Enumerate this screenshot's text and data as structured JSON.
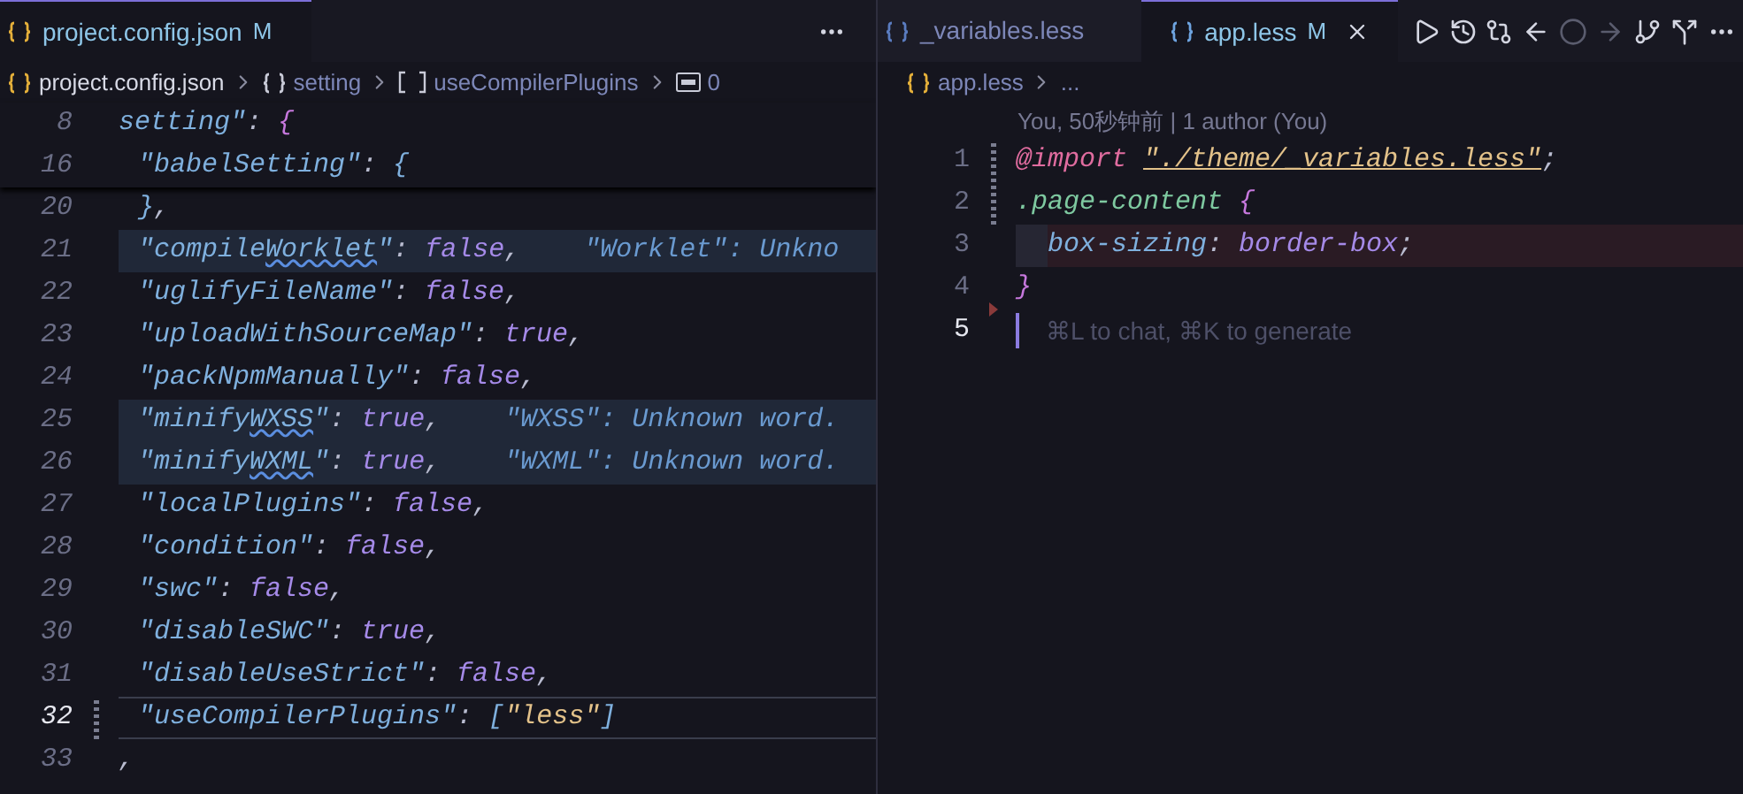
{
  "left_pane": {
    "tab": {
      "label": "project.config.json",
      "status": "M",
      "selected": true
    },
    "breadcrumbs": [
      {
        "label": "project.config.json",
        "kind": "file"
      },
      {
        "label": "setting",
        "kind": "object"
      },
      {
        "label": "useCompilerPlugins",
        "kind": "array"
      },
      {
        "label": "0",
        "kind": "string"
      }
    ],
    "sticky_lines": [
      {
        "number": "8",
        "indented": false,
        "tokens": [
          {
            "text": "setting\"",
            "kind": "key"
          },
          {
            "text": ": ",
            "kind": "punct"
          },
          {
            "text": "{",
            "kind": "brace"
          }
        ]
      },
      {
        "number": "16",
        "indented": true,
        "tokens": [
          {
            "text": "\"babelSetting\"",
            "kind": "key"
          },
          {
            "text": ": ",
            "kind": "punct"
          },
          {
            "text": "{",
            "kind": "key"
          }
        ]
      }
    ],
    "lines": [
      {
        "number": "20",
        "indented": true,
        "highlighted": false,
        "current": false,
        "modified": false,
        "tokens": [
          {
            "text": "}",
            "kind": "key"
          },
          {
            "text": ",",
            "kind": "punct"
          }
        ]
      },
      {
        "number": "21",
        "indented": true,
        "highlighted": true,
        "current": false,
        "modified": false,
        "tokens": [
          {
            "text": "\"compile",
            "kind": "key"
          },
          {
            "text": "Worklet",
            "kind": "key",
            "squiggle": true
          },
          {
            "text": "\"",
            "kind": "key"
          },
          {
            "text": ": ",
            "kind": "punct"
          },
          {
            "text": "false",
            "kind": "bool"
          },
          {
            "text": ",",
            "kind": "punct"
          }
        ],
        "hint": "\"Worklet\": Unkno"
      },
      {
        "number": "22",
        "indented": true,
        "highlighted": false,
        "current": false,
        "modified": false,
        "tokens": [
          {
            "text": "\"uglifyFileName\"",
            "kind": "key"
          },
          {
            "text": ": ",
            "kind": "punct"
          },
          {
            "text": "false",
            "kind": "bool"
          },
          {
            "text": ",",
            "kind": "punct"
          }
        ]
      },
      {
        "number": "23",
        "indented": true,
        "highlighted": false,
        "current": false,
        "modified": false,
        "tokens": [
          {
            "text": "\"uploadWithSourceMap\"",
            "kind": "key"
          },
          {
            "text": ": ",
            "kind": "punct"
          },
          {
            "text": "true",
            "kind": "bool"
          },
          {
            "text": ",",
            "kind": "punct"
          }
        ]
      },
      {
        "number": "24",
        "indented": true,
        "highlighted": false,
        "current": false,
        "modified": false,
        "tokens": [
          {
            "text": "\"packNpmManually\"",
            "kind": "key"
          },
          {
            "text": ": ",
            "kind": "punct"
          },
          {
            "text": "false",
            "kind": "bool"
          },
          {
            "text": ",",
            "kind": "punct"
          }
        ]
      },
      {
        "number": "25",
        "indented": true,
        "highlighted": true,
        "current": false,
        "modified": false,
        "tokens": [
          {
            "text": "\"minify",
            "kind": "key"
          },
          {
            "text": "WXSS",
            "kind": "key",
            "squiggle": true
          },
          {
            "text": "\"",
            "kind": "key"
          },
          {
            "text": ": ",
            "kind": "punct"
          },
          {
            "text": "true",
            "kind": "bool"
          },
          {
            "text": ",",
            "kind": "punct"
          }
        ],
        "hint": "\"WXSS\": Unknown word."
      },
      {
        "number": "26",
        "indented": true,
        "highlighted": true,
        "current": false,
        "modified": false,
        "tokens": [
          {
            "text": "\"minify",
            "kind": "key"
          },
          {
            "text": "WXML",
            "kind": "key",
            "squiggle": true
          },
          {
            "text": "\"",
            "kind": "key"
          },
          {
            "text": ": ",
            "kind": "punct"
          },
          {
            "text": "true",
            "kind": "bool"
          },
          {
            "text": ",",
            "kind": "punct"
          }
        ],
        "hint": "\"WXML\": Unknown word."
      },
      {
        "number": "27",
        "indented": true,
        "highlighted": false,
        "current": false,
        "modified": false,
        "tokens": [
          {
            "text": "\"localPlugins\"",
            "kind": "key"
          },
          {
            "text": ": ",
            "kind": "punct"
          },
          {
            "text": "false",
            "kind": "bool"
          },
          {
            "text": ",",
            "kind": "punct"
          }
        ]
      },
      {
        "number": "28",
        "indented": true,
        "highlighted": false,
        "current": false,
        "modified": false,
        "tokens": [
          {
            "text": "\"condition\"",
            "kind": "key"
          },
          {
            "text": ": ",
            "kind": "punct"
          },
          {
            "text": "false",
            "kind": "bool"
          },
          {
            "text": ",",
            "kind": "punct"
          }
        ]
      },
      {
        "number": "29",
        "indented": true,
        "highlighted": false,
        "current": false,
        "modified": false,
        "tokens": [
          {
            "text": "\"swc\"",
            "kind": "key"
          },
          {
            "text": ": ",
            "kind": "punct"
          },
          {
            "text": "false",
            "kind": "bool"
          },
          {
            "text": ",",
            "kind": "punct"
          }
        ]
      },
      {
        "number": "30",
        "indented": true,
        "highlighted": false,
        "current": false,
        "modified": false,
        "tokens": [
          {
            "text": "\"disableSWC\"",
            "kind": "key"
          },
          {
            "text": ": ",
            "kind": "punct"
          },
          {
            "text": "true",
            "kind": "bool"
          },
          {
            "text": ",",
            "kind": "punct"
          }
        ]
      },
      {
        "number": "31",
        "indented": true,
        "highlighted": false,
        "current": false,
        "modified": false,
        "tokens": [
          {
            "text": "\"disableUseStrict\"",
            "kind": "key"
          },
          {
            "text": ": ",
            "kind": "punct"
          },
          {
            "text": "false",
            "kind": "bool"
          },
          {
            "text": ",",
            "kind": "punct"
          }
        ]
      },
      {
        "number": "32",
        "indented": true,
        "highlighted": false,
        "current": true,
        "modified": true,
        "tokens": [
          {
            "text": "\"useCompilerPlugins\"",
            "kind": "key"
          },
          {
            "text": ": ",
            "kind": "punct"
          },
          {
            "text": "[",
            "kind": "key"
          },
          {
            "text": "\"less\"",
            "kind": "string"
          },
          {
            "text": "]",
            "kind": "key"
          }
        ]
      },
      {
        "number": "33",
        "indented": false,
        "highlighted": false,
        "current": false,
        "modified": false,
        "tokens": [
          {
            "text": ",",
            "kind": "punct"
          }
        ]
      }
    ]
  },
  "right_pane": {
    "tabs": [
      {
        "label": "_variables.less",
        "selected": false
      },
      {
        "label": "app.less",
        "status": "M",
        "selected": true
      }
    ],
    "toolbar": [
      {
        "kind": "run",
        "disabled": false
      },
      {
        "kind": "history",
        "disabled": false
      },
      {
        "kind": "compare",
        "disabled": false
      },
      {
        "kind": "back",
        "disabled": false
      },
      {
        "kind": "dot",
        "disabled": true
      },
      {
        "kind": "forward",
        "disabled": true
      },
      {
        "kind": "graph",
        "disabled": false
      },
      {
        "kind": "split",
        "disabled": false
      },
      {
        "kind": "more",
        "disabled": false
      }
    ],
    "breadcrumbs": [
      {
        "label": "app.less",
        "kind": "file"
      },
      {
        "label": "...",
        "kind": "more"
      }
    ],
    "blame": "You, 50秒钟前 | 1 author (You)",
    "lines": [
      {
        "number": "1",
        "indented": false,
        "highlighted": false,
        "current": false,
        "modified": true,
        "deleted": false,
        "tokens": [
          {
            "text": "@import",
            "kind": "at"
          },
          {
            "text": "\"./theme/_variables.less\"",
            "kind": "link"
          },
          {
            "text": ";",
            "kind": "punct"
          }
        ]
      },
      {
        "number": "2",
        "indented": false,
        "highlighted": false,
        "current": false,
        "modified": true,
        "deleted": false,
        "tokens": [
          {
            "text": ".page-content",
            "kind": "selector"
          },
          {
            "text": "{",
            "kind": "brace"
          }
        ]
      },
      {
        "number": "3",
        "indented": true,
        "highlighted": true,
        "current": false,
        "modified": false,
        "deleted": false,
        "tokens": [
          {
            "text": "box-sizing",
            "kind": "key"
          },
          {
            "text": ": ",
            "kind": "punct"
          },
          {
            "text": "border-box",
            "kind": "bool"
          },
          {
            "text": ";",
            "kind": "punct"
          }
        ]
      },
      {
        "number": "4",
        "indented": false,
        "highlighted": false,
        "current": false,
        "modified": false,
        "deleted": false,
        "tokens": [
          {
            "text": "}",
            "kind": "brace"
          }
        ]
      },
      {
        "number": "5",
        "indented": false,
        "highlighted": false,
        "current": true,
        "modified": false,
        "deleted": true,
        "ghost": "⌘L to chat, ⌘K to generate"
      }
    ]
  }
}
